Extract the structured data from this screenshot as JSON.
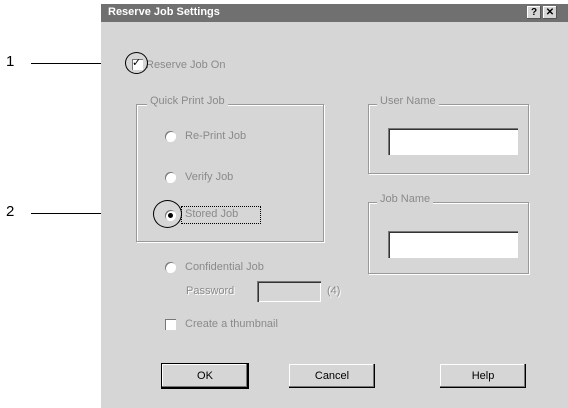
{
  "callouts": {
    "one": "1",
    "two": "2"
  },
  "window": {
    "title": "Reserve Job Settings",
    "help_glyph": "?",
    "close_glyph": "✕"
  },
  "reserve_job": {
    "label": "Reserve Job On",
    "checked": true
  },
  "quick_print": {
    "group_title": "Quick Print Job",
    "options": [
      {
        "label": "Re-Print Job",
        "selected": false
      },
      {
        "label": "Verify Job",
        "selected": false
      },
      {
        "label": "Stored Job",
        "selected": true
      }
    ]
  },
  "confidential": {
    "label": "Confidential Job",
    "password_label": "Password",
    "password_value": "",
    "password_hint": "(4)"
  },
  "thumbnail": {
    "label": "Create a thumbnail",
    "checked": false
  },
  "user_name": {
    "group_title": "User Name",
    "value": ""
  },
  "job_name": {
    "group_title": "Job Name",
    "value": ""
  },
  "buttons": {
    "ok": "OK",
    "cancel": "Cancel",
    "help": "Help"
  }
}
